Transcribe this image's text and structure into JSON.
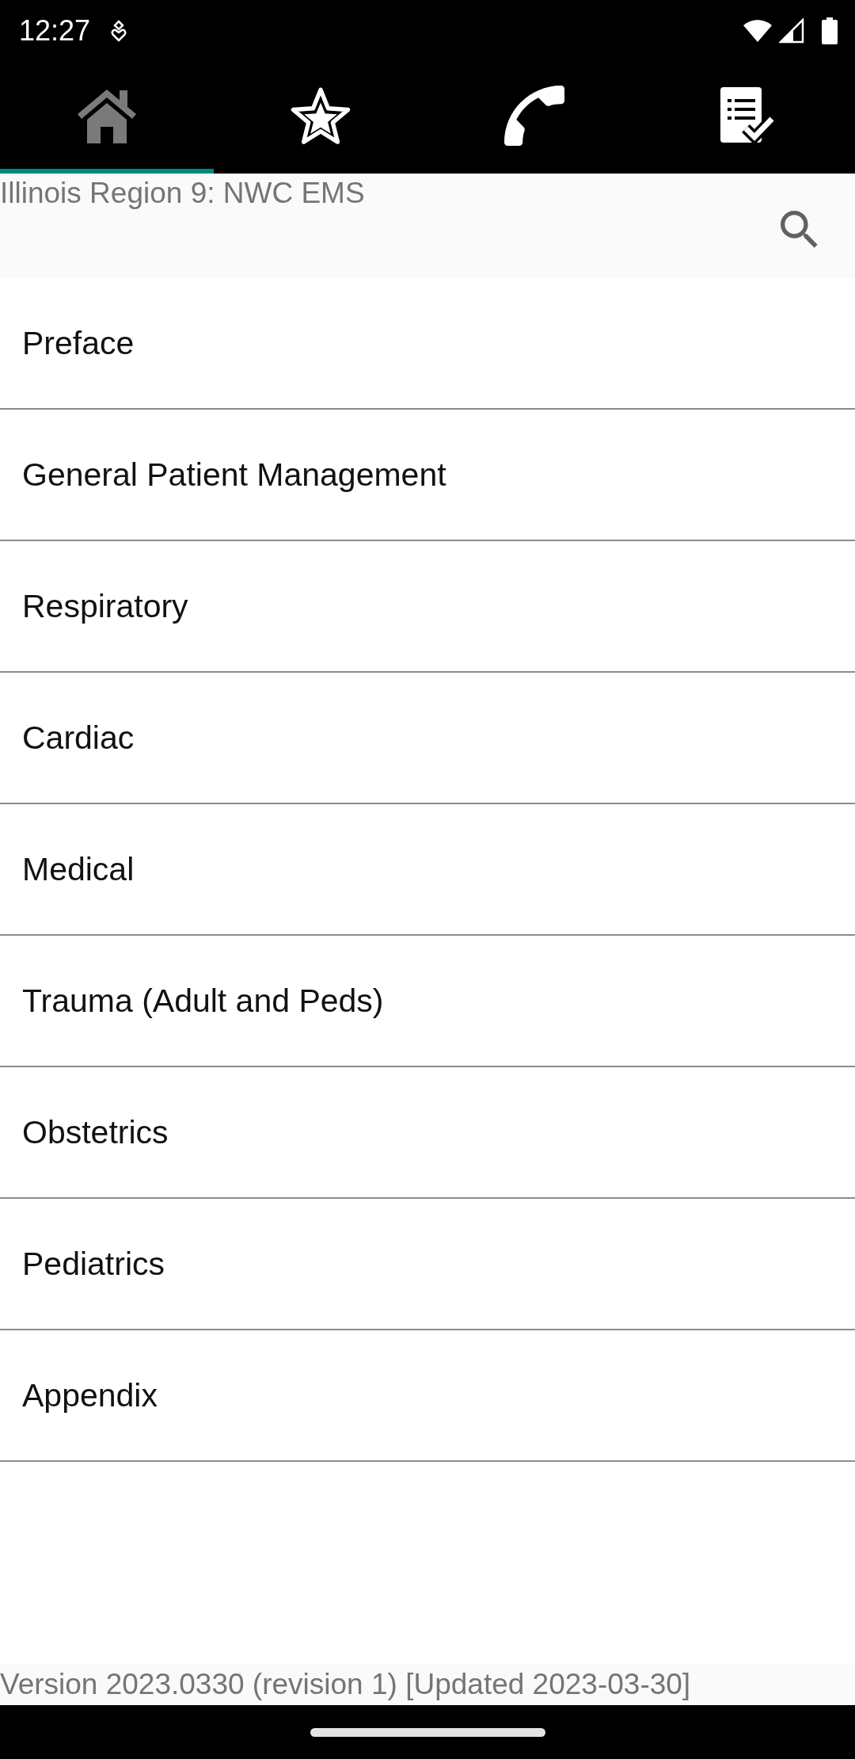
{
  "status_bar": {
    "time": "12:27"
  },
  "tabs": [
    {
      "kind": "home",
      "selected": true
    },
    {
      "kind": "favorites",
      "selected": false
    },
    {
      "kind": "phone",
      "selected": false
    },
    {
      "kind": "checklist",
      "selected": false
    }
  ],
  "header": {
    "title": "Illinois Region 9: NWC EMS"
  },
  "sections": [
    {
      "label": "Preface"
    },
    {
      "label": "General Patient Management"
    },
    {
      "label": "Respiratory"
    },
    {
      "label": "Cardiac"
    },
    {
      "label": "Medical"
    },
    {
      "label": "Trauma (Adult and Peds)"
    },
    {
      "label": "Obstetrics"
    },
    {
      "label": "Pediatrics"
    },
    {
      "label": "Appendix"
    }
  ],
  "footer": {
    "version": "Version 2023.0330 (revision 1) [Updated 2023-03-30]"
  }
}
